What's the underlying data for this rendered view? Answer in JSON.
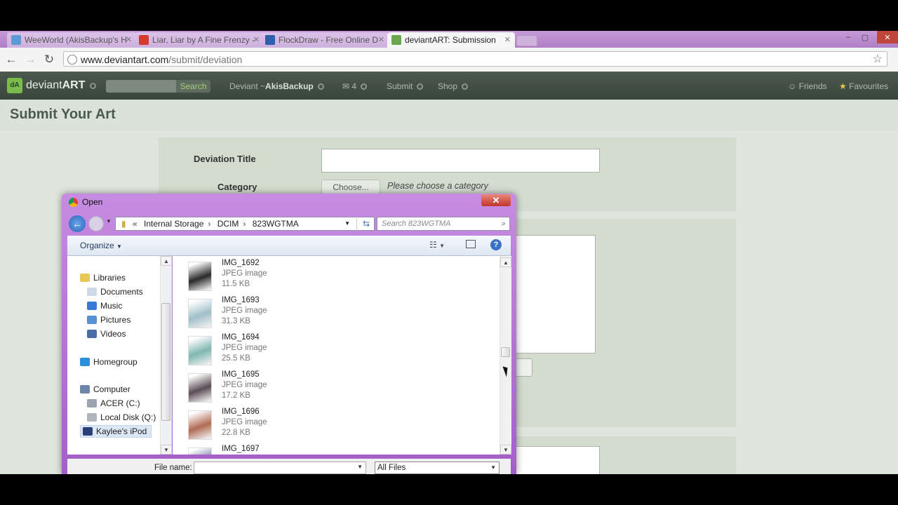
{
  "browser": {
    "tabs": [
      {
        "title": "WeeWorld (AkisBackup's H",
        "favicon_color": "#5a9bd5"
      },
      {
        "title": "Liar, Liar by A Fine Frenzy -",
        "favicon_color": "#d63a2b"
      },
      {
        "title": "FlockDraw - Free Online D",
        "favicon_color": "#2f5fa8"
      },
      {
        "title": "deviantART: Submission",
        "favicon_color": "#6aa84f"
      }
    ],
    "url_host": "www.deviantart.com",
    "url_path": "/submit/deviation",
    "window_controls": [
      "–",
      "▢",
      "✕"
    ]
  },
  "da_header": {
    "logo_text": "deviant",
    "logo_bold": "ART",
    "search_button": "Search",
    "deviant_prefix": "Deviant ~",
    "username": "AkisBackup",
    "messages_count": "4",
    "submit_label": "Submit",
    "shop_label": "Shop",
    "friends_label": "Friends",
    "favourites_label": "Favourites"
  },
  "page": {
    "title": "Submit Your Art",
    "deviation_title_label": "Deviation Title",
    "category_label": "Category",
    "choose_button": "Choose...",
    "category_hint": "Please choose a category"
  },
  "dialog": {
    "title": "Open",
    "breadcrumb": [
      "Internal Storage",
      "DCIM",
      "823WGTMA"
    ],
    "breadcrumb_prefix": "«",
    "search_placeholder": "Search 823WGTMA",
    "organize_label": "Organize",
    "nav_items": [
      {
        "label": "Libraries",
        "level": 0,
        "icon": "libraries-icon",
        "color": "#e7c65a"
      },
      {
        "label": "Documents",
        "level": 1,
        "icon": "documents-icon",
        "color": "#cfd8e6"
      },
      {
        "label": "Music",
        "level": 1,
        "icon": "music-icon",
        "color": "#3b7bd8"
      },
      {
        "label": "Pictures",
        "level": 1,
        "icon": "pictures-icon",
        "color": "#5a8fd6"
      },
      {
        "label": "Videos",
        "level": 1,
        "icon": "videos-icon",
        "color": "#4a6fa8"
      },
      {
        "label": "Homegroup",
        "level": 0,
        "icon": "homegroup-icon",
        "color": "#2d8fd8"
      },
      {
        "label": "Computer",
        "level": 0,
        "icon": "computer-icon",
        "color": "#6b86a8"
      },
      {
        "label": "ACER (C:)",
        "level": 1,
        "icon": "drive-icon",
        "color": "#9aa4b0"
      },
      {
        "label": "Local Disk (Q:)",
        "level": 1,
        "icon": "drive-icon",
        "color": "#b0b6bd"
      },
      {
        "label": "Kaylee's iPod",
        "level": 1,
        "icon": "ipod-icon",
        "color": "#2c3e7a",
        "selected": true
      }
    ],
    "files": [
      {
        "name": "IMG_1692",
        "type": "JPEG image",
        "size": "11.5 KB",
        "thumb": "#2a2a2a"
      },
      {
        "name": "IMG_1693",
        "type": "JPEG image",
        "size": "31.3 KB",
        "thumb": "#9fbfc9"
      },
      {
        "name": "IMG_1694",
        "type": "JPEG image",
        "size": "25.5 KB",
        "thumb": "#7fb7b0"
      },
      {
        "name": "IMG_1695",
        "type": "JPEG image",
        "size": "17.2 KB",
        "thumb": "#5a4d55"
      },
      {
        "name": "IMG_1696",
        "type": "JPEG image",
        "size": "22.8 KB",
        "thumb": "#b06a52"
      },
      {
        "name": "IMG_1697",
        "type": "",
        "size": "",
        "thumb": "#6a6f9a"
      }
    ],
    "file_name_label": "File name:",
    "file_name_value": "",
    "file_type_value": "All Files"
  }
}
